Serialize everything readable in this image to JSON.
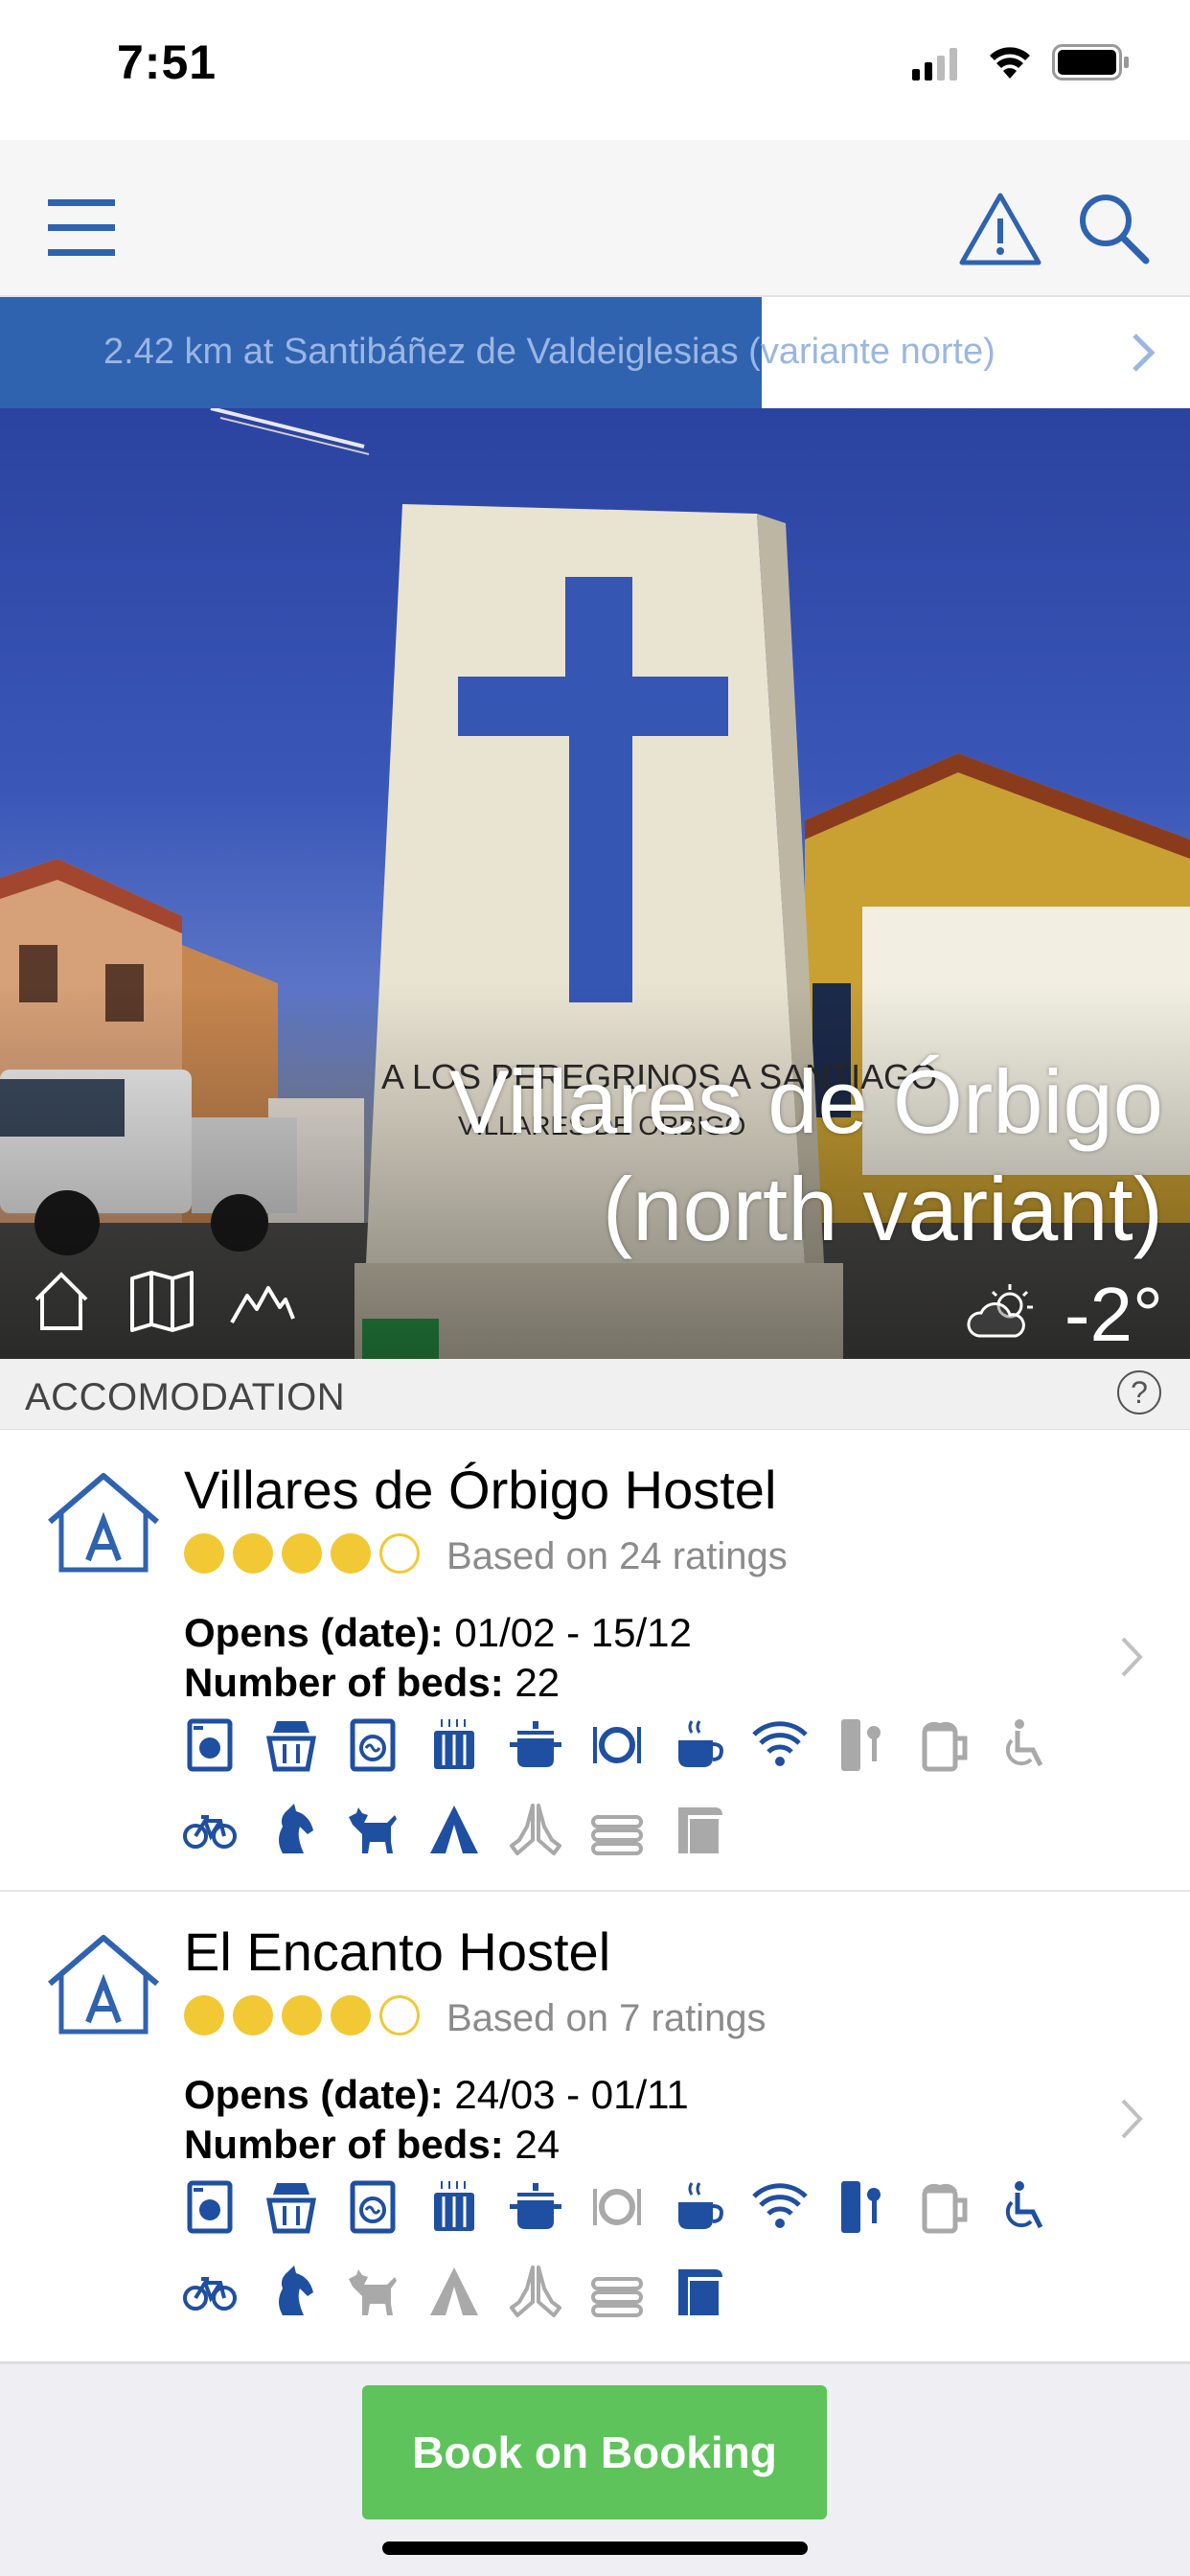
{
  "status_bar": {
    "time": "7:51"
  },
  "banner": {
    "text": "2.42 km at Santibáñez de Valdeiglesias (variante norte)",
    "progress_fraction": 0.64
  },
  "hero": {
    "title_line1": "Villares de Órbigo",
    "title_line2": "(north variant)",
    "temperature": "-2°",
    "icons": [
      "home-icon",
      "map-icon",
      "elevation-icon",
      "partly-cloudy-icon"
    ]
  },
  "section": {
    "title": "ACCOMODATION",
    "help": "?"
  },
  "accommodations": [
    {
      "name": "Villares de Órbigo Hostel",
      "rating_stars": 4,
      "rating_text": "Based on 24 ratings",
      "opens_label": "Opens (date):",
      "opens_value": "01/02 - 15/12",
      "beds_label": "Number of beds:",
      "beds_value": "22",
      "services_row1": [
        {
          "icon": "washer-icon",
          "on": true
        },
        {
          "icon": "laundry-basket-icon",
          "on": true
        },
        {
          "icon": "dryer-icon",
          "on": true
        },
        {
          "icon": "heating-icon",
          "on": true
        },
        {
          "icon": "cooking-pot-icon",
          "on": true
        },
        {
          "icon": "meals-icon",
          "on": true
        },
        {
          "icon": "coffee-icon",
          "on": true
        },
        {
          "icon": "wifi-icon",
          "on": true
        },
        {
          "icon": "locker-icon",
          "on": false
        },
        {
          "icon": "beer-icon",
          "on": false
        },
        {
          "icon": "wheelchair-icon",
          "on": false
        }
      ],
      "services_row2": [
        {
          "icon": "bicycle-icon",
          "on": true
        },
        {
          "icon": "horse-icon",
          "on": true
        },
        {
          "icon": "dog-icon",
          "on": true
        },
        {
          "icon": "tent-icon",
          "on": true
        },
        {
          "icon": "praying-hands-icon",
          "on": false
        },
        {
          "icon": "towels-icon",
          "on": false
        },
        {
          "icon": "sheets-icon",
          "on": false
        }
      ]
    },
    {
      "name": "El Encanto Hostel",
      "rating_stars": 4,
      "rating_text": "Based on 7 ratings",
      "opens_label": "Opens (date):",
      "opens_value": "24/03 - 01/11",
      "beds_label": "Number of beds:",
      "beds_value": "24",
      "services_row1": [
        {
          "icon": "washer-icon",
          "on": true
        },
        {
          "icon": "laundry-basket-icon",
          "on": true
        },
        {
          "icon": "dryer-icon",
          "on": true
        },
        {
          "icon": "heating-icon",
          "on": true
        },
        {
          "icon": "cooking-pot-icon",
          "on": true
        },
        {
          "icon": "meals-icon",
          "on": false
        },
        {
          "icon": "coffee-icon",
          "on": true
        },
        {
          "icon": "wifi-icon",
          "on": true
        },
        {
          "icon": "locker-icon",
          "on": true
        },
        {
          "icon": "beer-icon",
          "on": false
        },
        {
          "icon": "wheelchair-icon",
          "on": true
        }
      ],
      "services_row2": [
        {
          "icon": "bicycle-icon",
          "on": true
        },
        {
          "icon": "horse-icon",
          "on": true
        },
        {
          "icon": "dog-icon",
          "on": false
        },
        {
          "icon": "tent-icon",
          "on": false
        },
        {
          "icon": "praying-hands-icon",
          "on": false
        },
        {
          "icon": "towels-icon",
          "on": false
        },
        {
          "icon": "sheets-icon",
          "on": true
        }
      ]
    }
  ],
  "footer": {
    "book_label": "Book on Booking"
  },
  "colors": {
    "brand_blue": "#2f63b0",
    "icon_on": "#1f4fa1",
    "icon_off": "#a9a9a9",
    "star": "#f2c834",
    "book_green": "#5dc35a"
  }
}
